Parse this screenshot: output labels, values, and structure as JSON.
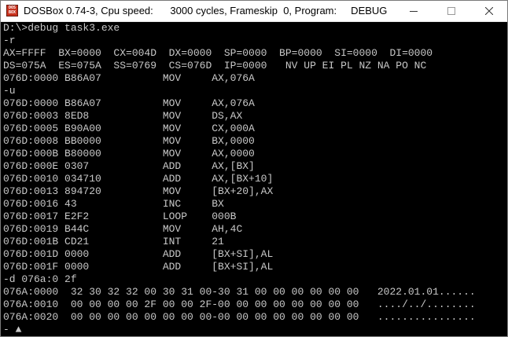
{
  "window": {
    "title": "DOSBox 0.74-3, Cpu speed:      3000 cycles, Frameskip  0, Program:     DEBUG",
    "icon_text": "DOS BOX",
    "icon": "dosbox-icon",
    "controls": {
      "minimize": "minimize-icon",
      "maximize": "maximize-icon",
      "close": "close-icon"
    }
  },
  "console": {
    "lines": [
      "D:\\>debug task3.exe",
      "-r",
      "AX=FFFF  BX=0000  CX=004D  DX=0000  SP=0000  BP=0000  SI=0000  DI=0000",
      "DS=075A  ES=075A  SS=0769  CS=076D  IP=0000   NV UP EI PL NZ NA PO NC",
      "076D:0000 B86A07          MOV     AX,076A",
      "-u",
      "076D:0000 B86A07          MOV     AX,076A",
      "076D:0003 8ED8            MOV     DS,AX",
      "076D:0005 B90A00          MOV     CX,000A",
      "076D:0008 BB0000          MOV     BX,0000",
      "076D:000B B80000          MOV     AX,0000",
      "076D:000E 0307            ADD     AX,[BX]",
      "076D:0010 034710          ADD     AX,[BX+10]",
      "076D:0013 894720          MOV     [BX+20],AX",
      "076D:0016 43              INC     BX",
      "076D:0017 E2F2            LOOP    000B",
      "076D:0019 B44C            MOV     AH,4C",
      "076D:001B CD21            INT     21",
      "076D:001D 0000            ADD     [BX+SI],AL",
      "076D:001F 0000            ADD     [BX+SI],AL",
      "-d 076a:0 2f",
      "076A:0000  32 30 32 32 00 30 31 00-30 31 00 00 00 00 00 00   2022.01.01......",
      "076A:0010  00 00 00 00 2F 00 00 2F-00 00 00 00 00 00 00 00   ..../../........",
      "076A:0020  00 00 00 00 00 00 00 00-00 00 00 00 00 00 00 00   ................",
      "- ▲"
    ]
  }
}
